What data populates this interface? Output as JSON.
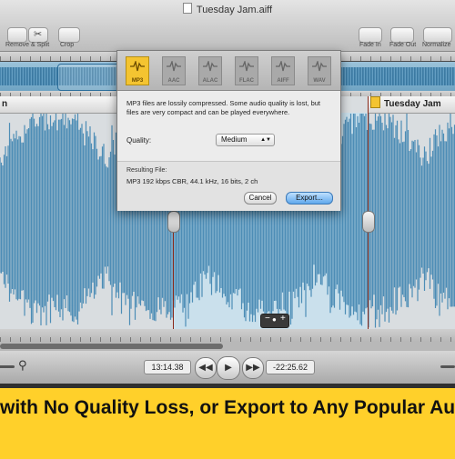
{
  "window": {
    "title": "Tuesday Jam.aiff"
  },
  "toolbar": {
    "remove_split_label": "Remove & Split",
    "crop_label": "Crop",
    "fade_in_label": "Fade In",
    "fade_out_label": "Fade Out",
    "normalize_label": "Normalize"
  },
  "track": {
    "name": "Tuesday Jam"
  },
  "dialog": {
    "formats": [
      {
        "label": "MP3",
        "active": true
      },
      {
        "label": "AAC",
        "active": false
      },
      {
        "label": "ALAC",
        "active": false
      },
      {
        "label": "FLAC",
        "active": false
      },
      {
        "label": "AIFF",
        "active": false
      },
      {
        "label": "WAV",
        "active": false
      }
    ],
    "description": "MP3 files are lossily compressed. Some audio quality is lost, but files are very compact and can be played everywhere.",
    "quality_label": "Quality:",
    "quality_value": "Medium",
    "result_label": "Resulting File:",
    "result_value": "MP3 192 kbps CBR, 44.1 kHz, 16 bits, 2 ch",
    "cancel_label": "Cancel",
    "export_label": "Export..."
  },
  "transport": {
    "current_time": "13:14.38",
    "remaining_time": "-22:25.62"
  },
  "banner": {
    "text": "with No Quality Loss, or Export to Any Popular Au"
  },
  "colors": {
    "banner": "#ffd02a",
    "waveform": "#4d8db6",
    "selection": "#bee1f5",
    "active_format": "#f4c431"
  }
}
